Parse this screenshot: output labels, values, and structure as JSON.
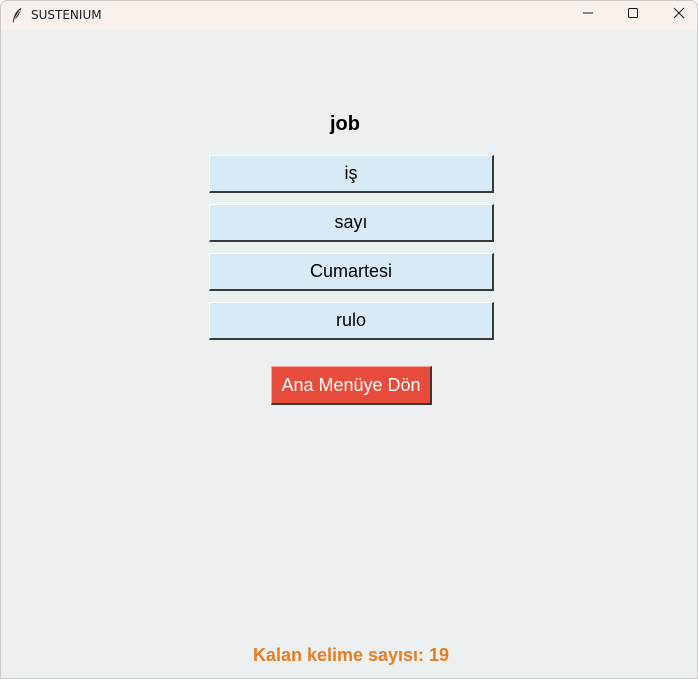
{
  "window": {
    "title": "SUSTENIUM",
    "icon": "feather-icon",
    "controls": [
      "minimize-icon",
      "maximize-icon",
      "close-icon"
    ]
  },
  "quiz": {
    "word": "job",
    "options": [
      {
        "label": "iş"
      },
      {
        "label": "sayı"
      },
      {
        "label": "Cumartesi"
      },
      {
        "label": "rulo"
      }
    ],
    "menu_button_label": "Ana Menüye Dön",
    "remaining_text": "Kalan kelime sayısı: 19"
  },
  "colors": {
    "background": "#ecf0f1",
    "option_bg": "#d9eaf7",
    "menu_button_bg": "#e74c3c",
    "remaining_text": "#e67e22"
  }
}
